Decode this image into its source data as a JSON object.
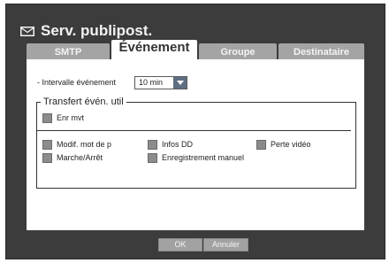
{
  "window": {
    "title": "Serv. publipost."
  },
  "tabs": [
    {
      "label": "SMTP",
      "active": false
    },
    {
      "label": "Événement",
      "active": true
    },
    {
      "label": "Groupe",
      "active": false
    },
    {
      "label": "Destinataire",
      "active": false
    }
  ],
  "interval": {
    "label": "- Intervalle événement",
    "value": "10 min"
  },
  "transfer": {
    "legend": "Transfert évén. util",
    "enr": "Enr mvt",
    "items": [
      "Modif. mot de p",
      "Infos DD",
      "Perte vidéo",
      "Marche/Arrêt",
      "Enregistrement manuel"
    ]
  },
  "buttons": {
    "ok": "OK",
    "cancel": "Annuler"
  },
  "colors": {
    "window_bg": "#3c3c3c",
    "tab_inactive": "#a4a4a4",
    "panel": "#ffffff",
    "dropdown_arrow": "#5f6f84"
  }
}
